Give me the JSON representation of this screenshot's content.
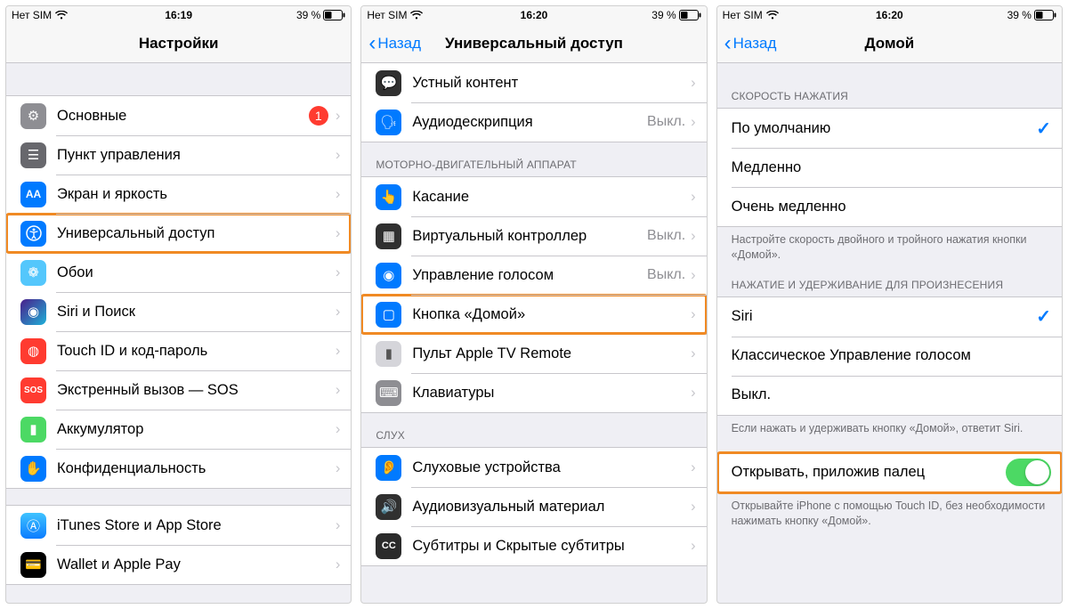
{
  "status": {
    "carrier": "Нет SIM",
    "time1": "16:19",
    "time2": "16:20",
    "time3": "16:20",
    "battery": "39 %"
  },
  "nav": {
    "back": "Назад",
    "title1": "Настройки",
    "title2": "Универсальный доступ",
    "title3": "Домой"
  },
  "screen1": {
    "rows": {
      "general": "Основные",
      "general_badge": "1",
      "control_center": "Пункт управления",
      "display": "Экран и яркость",
      "accessibility": "Универсальный доступ",
      "wallpaper": "Обои",
      "siri": "Siri и Поиск",
      "touchid": "Touch ID и код-пароль",
      "sos": "Экстренный вызов — SOS",
      "battery": "Аккумулятор",
      "privacy": "Конфиденциальность",
      "itunes": "iTunes Store и App Store",
      "wallet": "Wallet и Apple Pay"
    }
  },
  "screen2": {
    "rows": {
      "spoken": "Устный контент",
      "audiodesc": "Аудиодескрипция",
      "audiodesc_val": "Выкл.",
      "section_motor": "МОТОРНО-ДВИГАТЕЛЬНЫЙ АППАРАТ",
      "touch": "Касание",
      "switch": "Виртуальный контроллер",
      "switch_val": "Выкл.",
      "voice": "Управление голосом",
      "voice_val": "Выкл.",
      "home": "Кнопка «Домой»",
      "appletv": "Пульт Apple TV Remote",
      "keyboards": "Клавиатуры",
      "section_hearing": "СЛУХ",
      "hearing": "Слуховые устройства",
      "audiovis": "Аудиовизуальный материал",
      "subtitles": "Субтитры и Скрытые субтитры"
    }
  },
  "screen3": {
    "sec1": "СКОРОСТЬ НАЖАТИЯ",
    "r_default": "По умолчанию",
    "r_slow": "Медленно",
    "r_slowest": "Очень медленно",
    "foot1": "Настройте скорость двойного и тройного нажатия кнопки «Домой».",
    "sec2": "НАЖАТИЕ И УДЕРЖИВАНИЕ ДЛЯ ПРОИЗНЕСЕНИЯ",
    "r_siri": "Siri",
    "r_classic": "Классическое Управление голосом",
    "r_off": "Выкл.",
    "foot2": "Если нажать и удерживать кнопку «Домой», ответит Siri.",
    "r_rest": "Открывать, приложив палец",
    "foot3": "Открывайте iPhone с помощью Touch ID, без необходимости нажимать кнопку «Домой»."
  }
}
